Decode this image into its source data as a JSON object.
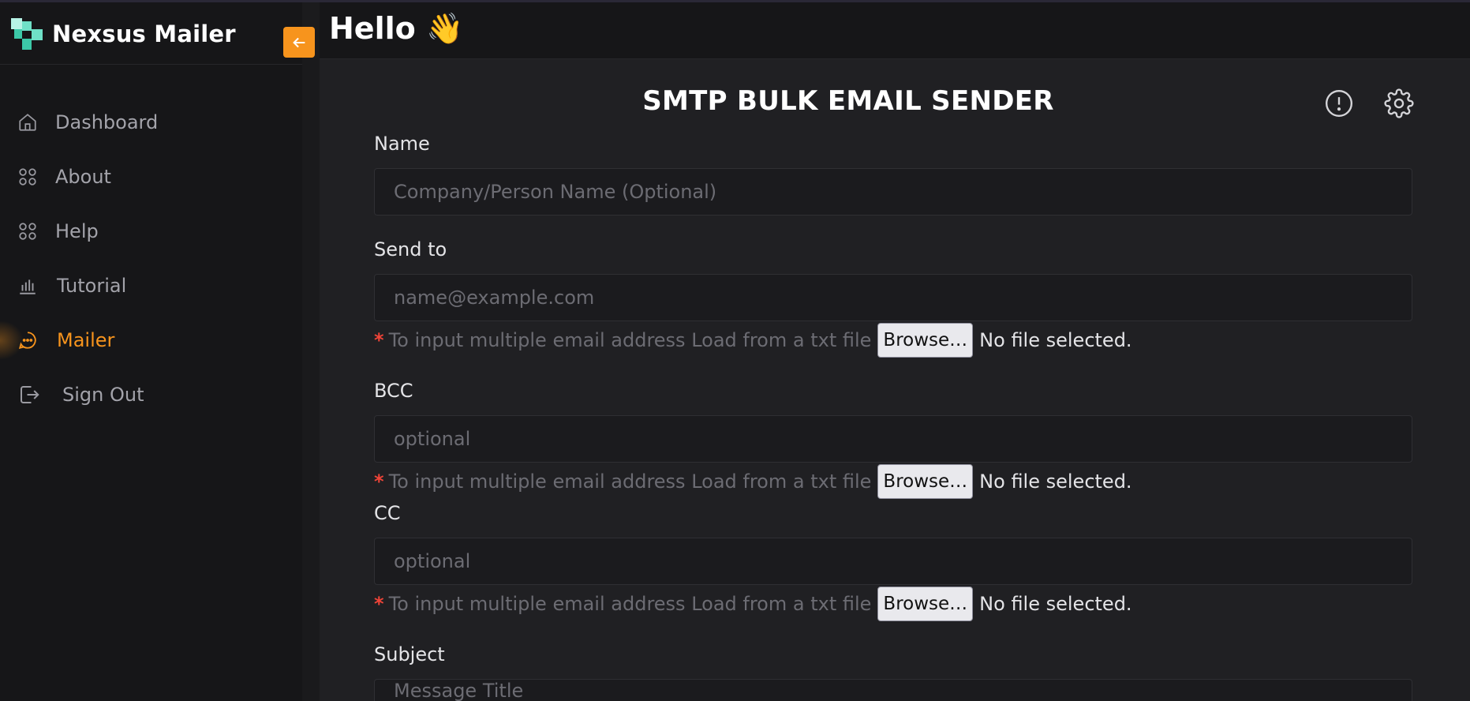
{
  "app": {
    "name": "Nexsus Mailer"
  },
  "header": {
    "greeting": "Hello 👋"
  },
  "sidebar": {
    "items": [
      {
        "label": "Dashboard",
        "icon": "home-icon"
      },
      {
        "label": "About",
        "icon": "grid-icon"
      },
      {
        "label": "Help",
        "icon": "grid-icon"
      },
      {
        "label": "Tutorial",
        "icon": "bar-chart-icon"
      },
      {
        "label": "Mailer",
        "icon": "chat-icon",
        "active": true
      },
      {
        "label": "Sign Out",
        "icon": "logout-icon"
      }
    ]
  },
  "main": {
    "title": "SMTP BULK EMAIL SENDER",
    "fields": {
      "name": {
        "label": "Name",
        "placeholder": "Company/Person Name (Optional)"
      },
      "send_to": {
        "label": "Send to",
        "placeholder": "name@example.com"
      },
      "bcc": {
        "label": "BCC",
        "placeholder": "optional"
      },
      "cc": {
        "label": "CC",
        "placeholder": "optional"
      },
      "subject": {
        "label": "Subject",
        "placeholder": "Message Title"
      }
    },
    "file_helper": {
      "asterisk": "*",
      "text": "To input multiple email address Load from a txt file",
      "browse_label": "Browse…",
      "status": "No file selected."
    }
  },
  "colors": {
    "accent": "#f7941d",
    "background": "#202023",
    "sidebar": "#161618",
    "required": "#f04438"
  }
}
